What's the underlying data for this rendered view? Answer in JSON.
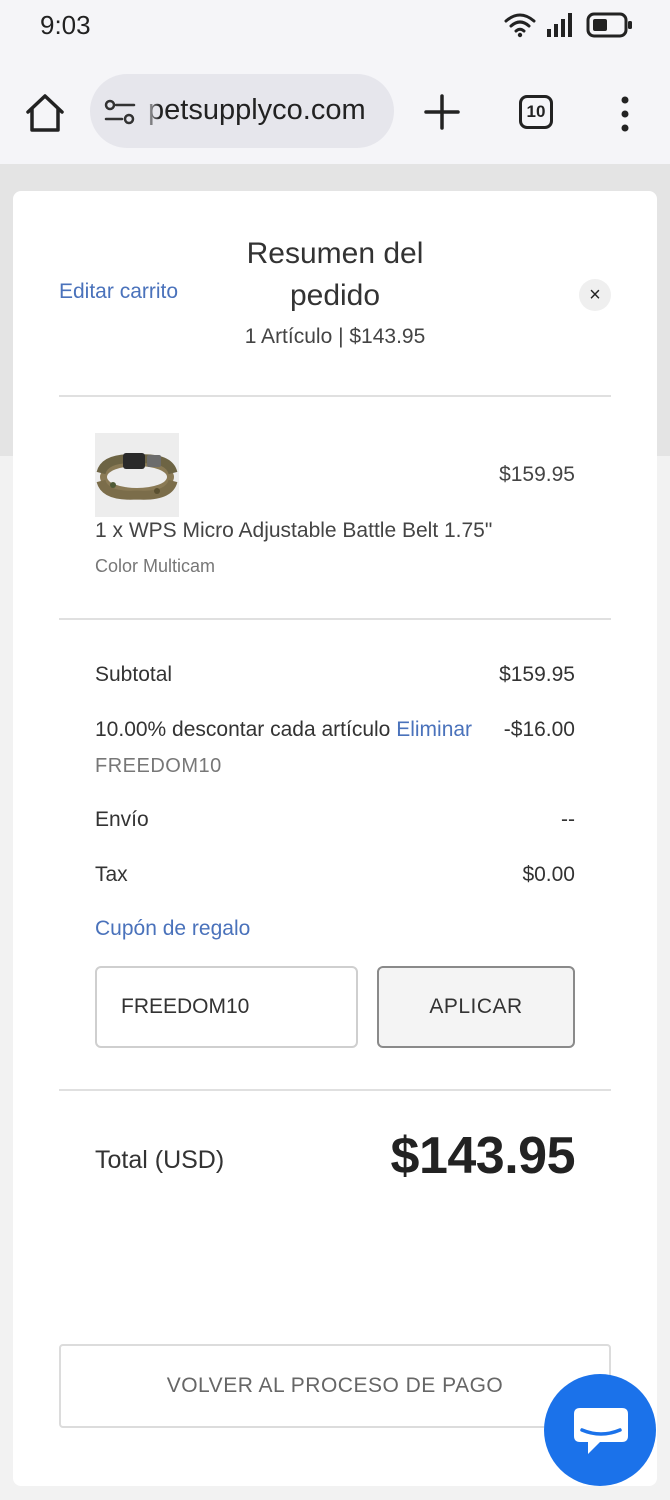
{
  "status_bar": {
    "time": "9:03"
  },
  "browser": {
    "url": "petsupplyco.com",
    "tab_count": "10"
  },
  "modal": {
    "edit_cart_label": "Editar carrito",
    "title": "Resumen del pedido",
    "subtitle": "1 Artículo | $143.95",
    "close_glyph": "×"
  },
  "item": {
    "name": "1 x WPS Micro Adjustable Battle Belt 1.75\"",
    "variant": "Color Multicam",
    "price": "$159.95"
  },
  "summary": {
    "subtotal_label": "Subtotal",
    "subtotal_value": "$159.95",
    "discount_label": "10.00% descontar cada artículo",
    "discount_remove_label": "Eliminar",
    "discount_value": "-$16.00",
    "discount_code": "FREEDOM10",
    "shipping_label": "Envío",
    "shipping_value": "--",
    "tax_label": "Tax",
    "tax_value": "$0.00"
  },
  "coupon": {
    "gift_coupon_label": "Cupón de regalo",
    "input_value": "FREEDOM10",
    "apply_label": "APLICAR"
  },
  "total": {
    "label": "Total (USD)",
    "value": "$143.95"
  },
  "footer": {
    "back_label": "VOLVER AL PROCESO DE PAGO"
  },
  "colors": {
    "link": "#4a72bb",
    "chat_button": "#1b72ea"
  },
  "icons": [
    "home-icon",
    "tune-icon",
    "plus-icon",
    "tabs-icon",
    "more-vert-icon",
    "close-icon",
    "chat-icon",
    "wifi-icon",
    "signal-icon",
    "battery-icon"
  ]
}
